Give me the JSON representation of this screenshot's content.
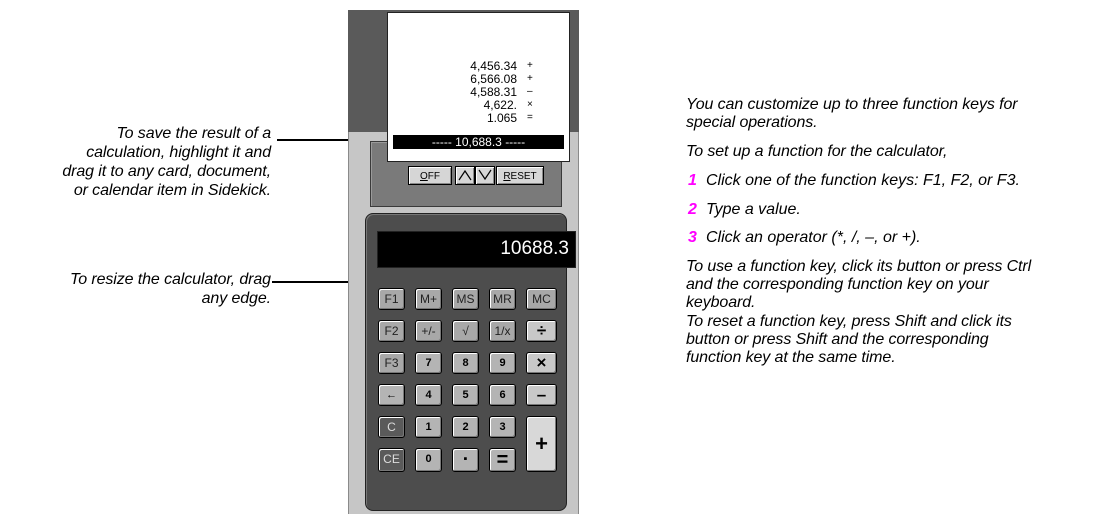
{
  "callouts": {
    "save_result": [
      "To save the result of a",
      "calculation, highlight it and",
      "drag it to any card, document,",
      "or calendar item in Sidekick."
    ],
    "resize": [
      "To resize the calculator, drag",
      "any edge."
    ]
  },
  "tape": {
    "lines": [
      {
        "value": "4,456.34",
        "op": "+"
      },
      {
        "value": "6,566.08",
        "op": "+"
      },
      {
        "value": "4,588.31",
        "op": "–"
      },
      {
        "value": "4,622.",
        "op": "×"
      },
      {
        "value": "1.065",
        "op": "="
      }
    ],
    "total": "----- 10,688.3 -----"
  },
  "controls": {
    "off_label_ul": "O",
    "off_label_rest": "FF",
    "reset_label_ul": "R",
    "reset_label_rest": "ESET",
    "up_icon": "triangle-up-icon",
    "down_icon": "triangle-down-icon"
  },
  "display": "10688.3",
  "keys": {
    "row1": [
      "F1",
      "M+",
      "MS",
      "MR",
      "MC"
    ],
    "row2": [
      "F2",
      "+/-",
      "√",
      "1/x",
      "÷"
    ],
    "row3": [
      "F3",
      "7",
      "8",
      "9",
      "×"
    ],
    "row4": [
      "←",
      "4",
      "5",
      "6",
      "–"
    ],
    "row5": [
      "C",
      "1",
      "2",
      "3"
    ],
    "row6": [
      "CE",
      "0",
      "▪",
      "="
    ],
    "plus": "+"
  },
  "instructions": {
    "intro": [
      "You can customize up to three function keys for",
      "special operations."
    ],
    "setup": "To set up a function for the calculator,",
    "steps": [
      {
        "num": "1",
        "text": "Click one of the function keys: F1, F2, or F3."
      },
      {
        "num": "2",
        "text": "Type a value."
      },
      {
        "num": "3",
        "text": "Click an operator (*, /, –, or +)."
      }
    ],
    "use": [
      "To use a function key, click its button or press Ctrl",
      "and the corresponding function key on your",
      "keyboard."
    ],
    "reset": [
      "To reset a function key, press Shift and click its",
      "button or press Shift and the corresponding",
      "function key at the same time."
    ]
  },
  "colors": {
    "step_number": "#ff00ff",
    "display_bg": "#000000",
    "display_text": "#ffffff"
  }
}
